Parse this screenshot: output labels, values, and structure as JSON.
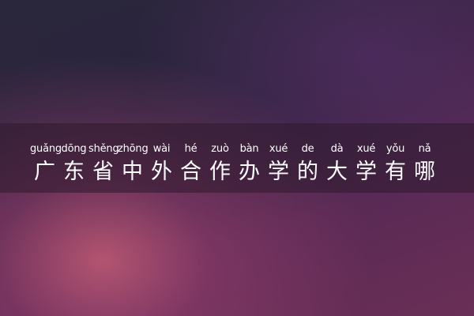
{
  "title": {
    "pinyin": [
      "guǎng",
      "dōng",
      "shěng",
      "zhōng",
      "wài",
      "hé",
      "zuò",
      "bàn",
      "xué",
      "de",
      "dà",
      "xué",
      "yǒu",
      "nǎ"
    ],
    "hanzi": [
      "广",
      "东",
      "省",
      "中",
      "外",
      "合",
      "作",
      "办",
      "学",
      "的",
      "大",
      "学",
      "有",
      "哪"
    ]
  },
  "colors": {
    "text": "#ffffff",
    "banner": "#2d192d",
    "background_dark": "#2c2a3a",
    "background_glow": "#c45c76"
  }
}
